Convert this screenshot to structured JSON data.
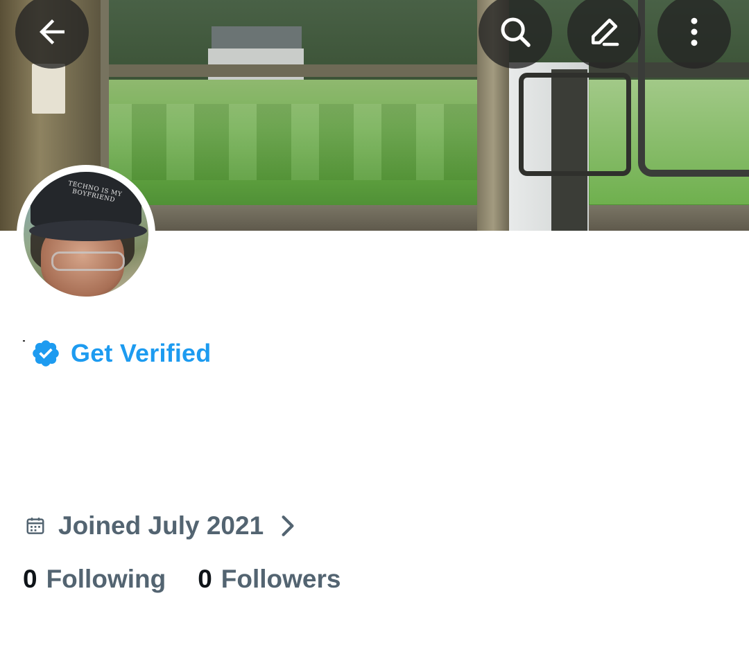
{
  "header": {
    "back_icon": "arrow-left-icon",
    "search_icon": "search-icon",
    "edit_icon": "pencil-icon",
    "more_icon": "more-vertical-icon"
  },
  "banner": {
    "description_icon": "banner-image"
  },
  "avatar": {
    "cap_text_line1": "TECHNO IS MY",
    "cap_text_line2": "BOYFRIEND"
  },
  "verified": {
    "label": "Get Verified",
    "color": "#1d9bf0"
  },
  "joined": {
    "text": "Joined July 2021"
  },
  "stats": {
    "following_count": "0",
    "following_label": "Following",
    "followers_count": "0",
    "followers_label": "Followers"
  },
  "colors": {
    "text_primary": "#0f1419",
    "text_secondary": "#536471",
    "accent": "#1d9bf0"
  }
}
